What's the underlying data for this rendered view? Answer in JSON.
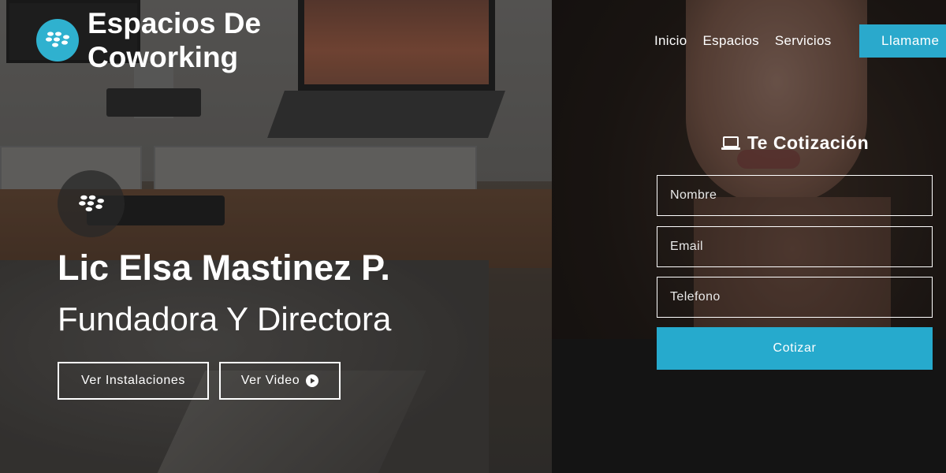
{
  "colors": {
    "accent": "#2aa9cc",
    "logo": "#2fb1cf",
    "text": "#ffffff"
  },
  "header": {
    "brand_line1": "Espacios De",
    "brand_line2": "Coworking",
    "logo_icon": "blackberry-icon",
    "nav": [
      {
        "label": "Inicio"
      },
      {
        "label": "Espacios"
      },
      {
        "label": "Servicios"
      }
    ],
    "call_button": "Llamame"
  },
  "hero": {
    "icon": "blackberry-icon",
    "name": "Lic Elsa Mastinez P.",
    "role": "Fundadora Y Directora",
    "buttons": {
      "instalaciones": "Ver Instalaciones",
      "video": "Ver Video",
      "video_icon": "play-circle-icon"
    }
  },
  "quote_form": {
    "title": "Te Cotización",
    "title_icon": "laptop-icon",
    "fields": {
      "nombre_placeholder": "Nombre",
      "email_placeholder": "Email",
      "telefono_placeholder": "Telefono"
    },
    "submit": "Cotizar"
  }
}
